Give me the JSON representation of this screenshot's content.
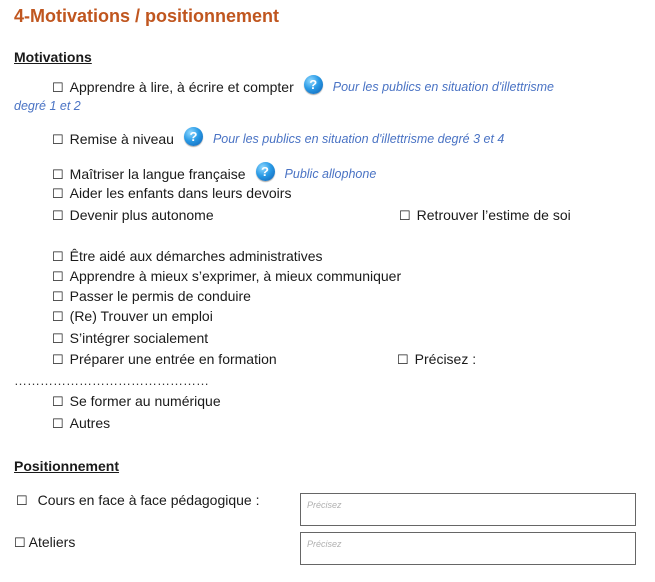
{
  "title": "4-Motivations / positionnement",
  "motivations": {
    "heading": "Motivations",
    "checkbox_glyph": "☐",
    "help_icon": "question-mark-icon",
    "items": {
      "lire": "Apprendre à lire, à écrire et compter",
      "lire_hint_a": "Pour les publics en situation d'illettrisme",
      "lire_hint_b": "degré 1 et 2",
      "remise": "Remise à niveau",
      "remise_hint": "Pour les publics en situation d'illettrisme degré 3 et 4",
      "langue": "Maîtriser la langue française",
      "langue_hint": "Public allophone",
      "enfants": "Aider les enfants dans leurs devoirs",
      "autonome": "Devenir plus autonome",
      "estime": "Retrouver l’estime de soi",
      "demarches": "Être aidé aux démarches administratives",
      "exprimer": "Apprendre à mieux s’exprimer, à mieux communiquer",
      "permis": "Passer le permis de conduire",
      "emploi": "(Re) Trouver un emploi",
      "integrer": "S’intégrer socialement",
      "formation": "Préparer une entrée en formation",
      "precisez": "Précisez :",
      "dots": "………………………………………",
      "numerique": "Se former au numérique",
      "autres": "Autres"
    }
  },
  "positionnement": {
    "heading": "Positionnement",
    "cours_label": "Cours en face à face pédagogique :",
    "cours_placeholder": "Précisez",
    "ateliers_label": "Ateliers",
    "ateliers_placeholder": "Précisez"
  }
}
